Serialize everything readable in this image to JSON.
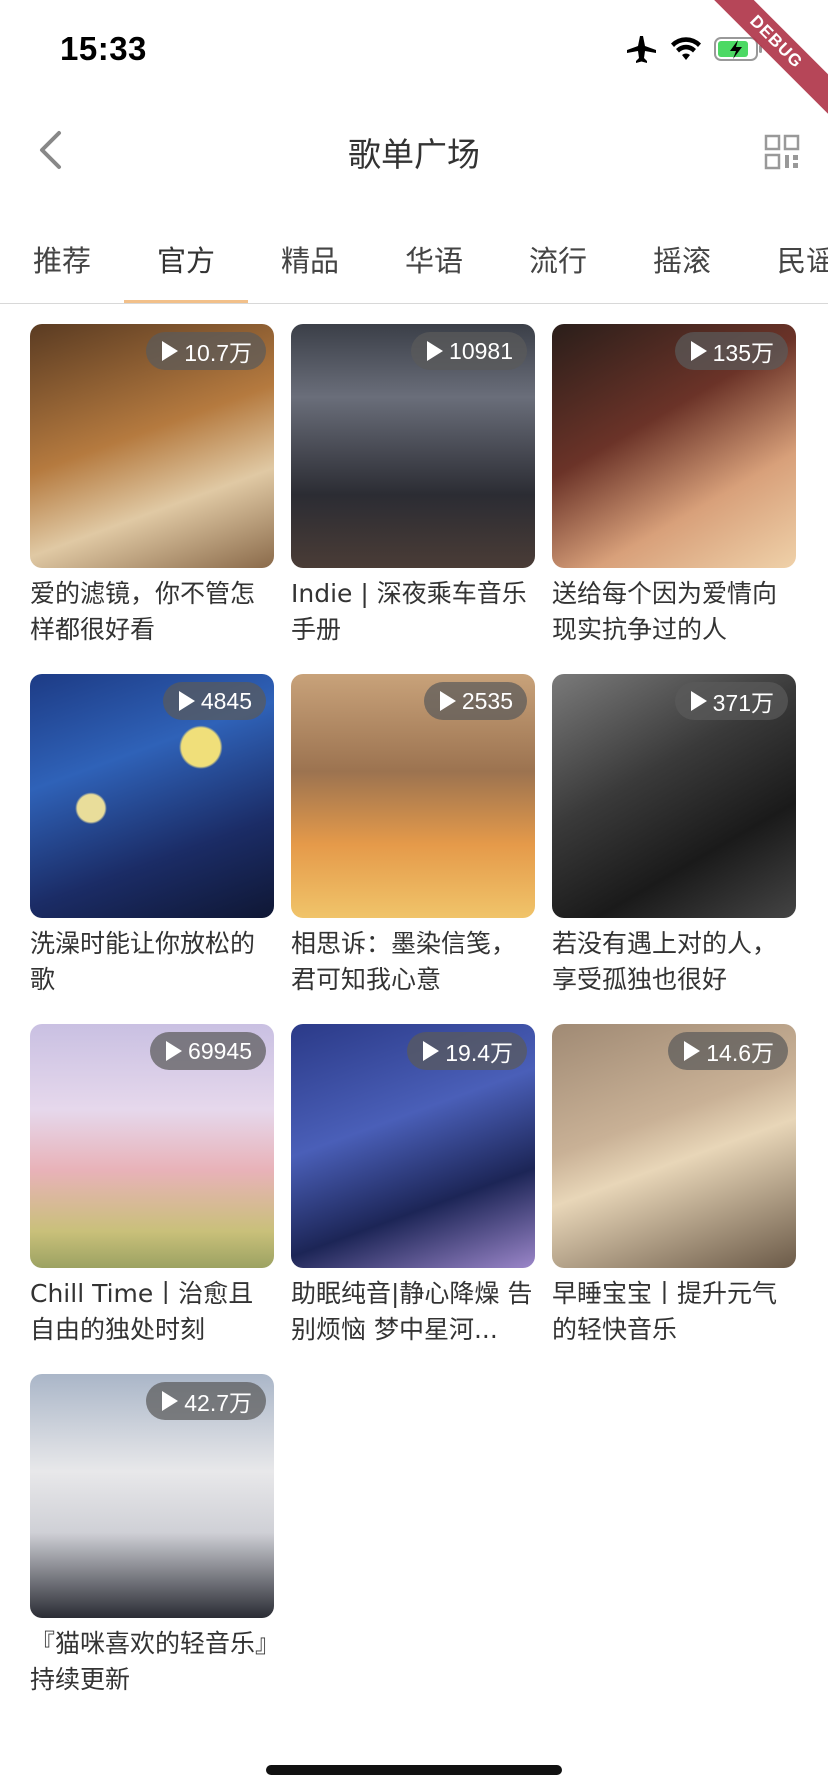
{
  "status": {
    "time": "15:33"
  },
  "debug_label": "DEBUG",
  "nav": {
    "title": "歌单广场"
  },
  "tabs": [
    "推荐",
    "官方",
    "精品",
    "华语",
    "流行",
    "摇滚",
    "民谣"
  ],
  "active_tab": "官方",
  "playlists": [
    {
      "plays": "10.7万",
      "name": "爱的滤镜，你不管怎样都很好看"
    },
    {
      "plays": "10981",
      "name": "Indie | 深夜乘车音乐手册"
    },
    {
      "plays": "135万",
      "name": "送给每个因为爱情向现实抗争过的人"
    },
    {
      "plays": "4845",
      "name": "洗澡时能让你放松的歌"
    },
    {
      "plays": "2535",
      "name": "相思诉：墨染信笺，君可知我心意"
    },
    {
      "plays": "371万",
      "name": "若没有遇上对的人，享受孤独也很好"
    },
    {
      "plays": "69945",
      "name": "Chill Time丨治愈且自由的独处时刻"
    },
    {
      "plays": "19.4万",
      "name": "助眠纯音|静心降燥 告别烦恼 梦中星河..."
    },
    {
      "plays": "14.6万",
      "name": "早睡宝宝丨提升元气的轻快音乐"
    },
    {
      "plays": "42.7万",
      "name": "『猫咪喜欢的轻音乐』持续更新"
    }
  ]
}
